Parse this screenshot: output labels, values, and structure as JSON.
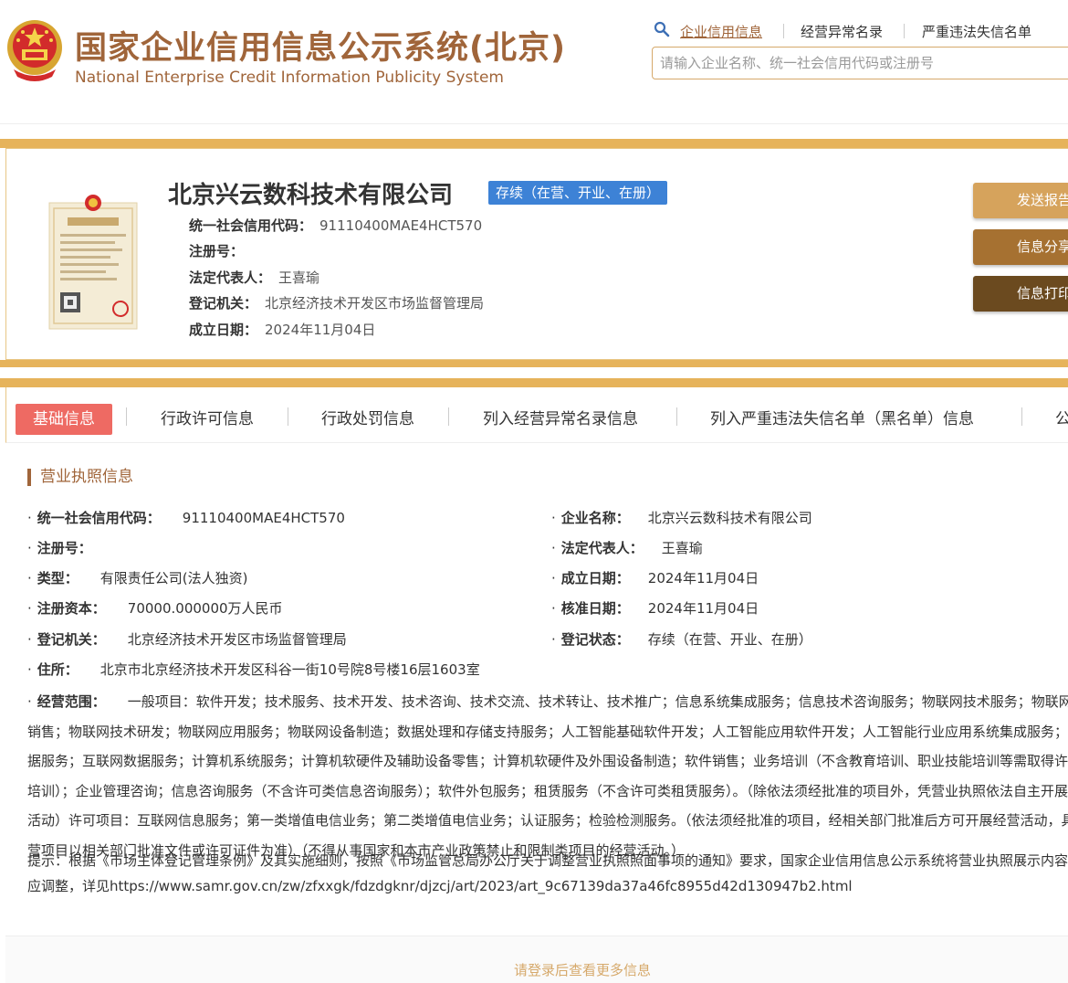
{
  "header": {
    "title": "国家企业信用信息公示系统(北京)",
    "subtitle": "National Enterprise Credit Information Publicity System",
    "tabs": [
      {
        "label": "企业信用信息",
        "active": true
      },
      {
        "label": "经营异常名录",
        "active": false
      },
      {
        "label": "严重违法失信名单",
        "active": false
      }
    ],
    "search_placeholder": "请输入企业名称、统一社会信用代码或注册号"
  },
  "company": {
    "name": "北京兴云数科技术有限公司",
    "status": "存续（在营、开业、在册）",
    "info": [
      {
        "label": "统一社会信用代码：",
        "value": "91110400MAE4HCT570"
      },
      {
        "label": "注册号：",
        "value": ""
      },
      {
        "label": "法定代表人：",
        "value": "王喜瑜"
      },
      {
        "label": "登记机关：",
        "value": "北京经济技术开发区市场监督管理局"
      },
      {
        "label": "成立日期：",
        "value": "2024年11月04日"
      }
    ]
  },
  "actions": [
    {
      "label": "发送报告",
      "color": "#d6a35c"
    },
    {
      "label": "信息分享",
      "color": "#a67131"
    },
    {
      "label": "信息打印",
      "color": "#6b4a1f"
    }
  ],
  "nav": {
    "tabs": [
      {
        "label": "基础信息",
        "active": true
      },
      {
        "label": "行政许可信息",
        "active": false
      },
      {
        "label": "行政处罚信息",
        "active": false
      },
      {
        "label": "列入经营异常名录信息",
        "active": false
      },
      {
        "label": "列入严重违法失信名单（黑名单）信息",
        "active": false
      },
      {
        "label": "公",
        "active": false
      }
    ]
  },
  "license": {
    "section_title": "营业执照信息",
    "left": [
      {
        "label": "统一社会信用代码：",
        "value": "91110400MAE4HCT570"
      },
      {
        "label": "注册号：",
        "value": ""
      },
      {
        "label": "类型：",
        "value": "有限责任公司(法人独资)"
      },
      {
        "label": "注册资本：",
        "value": "70000.000000万人民币"
      },
      {
        "label": "登记机关：",
        "value": "北京经济技术开发区市场监督管理局"
      }
    ],
    "right": [
      {
        "label": "企业名称：",
        "value": "北京兴云数科技术有限公司"
      },
      {
        "label": "法定代表人：",
        "value": "王喜瑜"
      },
      {
        "label": "成立日期：",
        "value": "2024年11月04日"
      },
      {
        "label": "核准日期：",
        "value": "2024年11月04日"
      },
      {
        "label": "登记状态：",
        "value": "存续（在营、开业、在册）"
      }
    ],
    "address": {
      "label": "住所：",
      "value": "北京市北京经济技术开发区科谷一街10号院8号楼16层1603室"
    },
    "scope": {
      "label": "经营范围：",
      "value": "一般项目：软件开发；技术服务、技术开发、技术咨询、技术交流、技术转让、技术推广；信息系统集成服务；信息技术咨询服务；物联网技术服务；物联网设备销售；物联网技术研发；物联网应用服务；物联网设备制造；数据处理和存储支持服务；人工智能基础软件开发；人工智能应用软件开发；人工智能行业应用系统集成服务；大数据服务；互联网数据服务；计算机系统服务；计算机软硬件及辅助设备零售；计算机软硬件及外围设备制造；软件销售；业务培训（不含教育培训、职业技能培训等需取得许可的培训）；企业管理咨询；信息咨询服务（不含许可类信息咨询服务）；软件外包服务；租赁服务（不含许可类租赁服务）。（除依法须经批准的项目外，凭营业执照依法自主开展经营活动）许可项目：互联网信息服务；第一类增值电信业务；第二类增值电信业务；认证服务；检验检测服务。（依法须经批准的项目，经相关部门批准后方可开展经营活动，具体经营项目以相关部门批准文件或许可证件为准）（不得从事国家和本市产业政策禁止和限制类项目的经营活动。）"
    },
    "notice": "提示：根据《市场主体登记管理条例》及其实施细则，按照《市场监管总局办公厅关于调整营业执照照面事项的通知》要求，国家企业信用信息公示系统将营业执照展示内容作相应调整，详见https://www.samr.gov.cn/zw/zfxxgk/fdzdgknr/djzcj/art/2023/art_9c67139da37a46fc8955d42d130947b2.html"
  },
  "footer": {
    "login_text": "请登录后查看更多信息"
  }
}
